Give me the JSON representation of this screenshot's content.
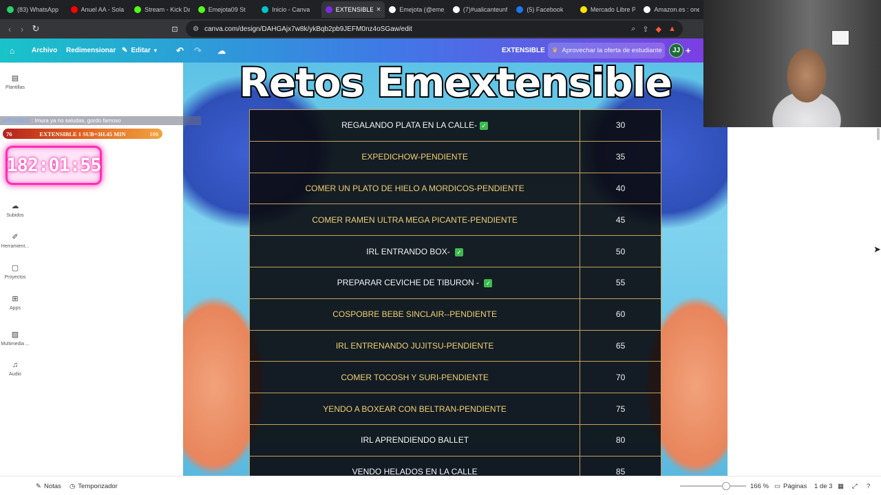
{
  "browser": {
    "tabs": [
      {
        "title": "(83) WhatsApp",
        "favicon_color": "#25d366",
        "icon": "whatsapp-icon"
      },
      {
        "title": "Anuel AA - Sola",
        "favicon_color": "#ff0000",
        "icon": "youtube-icon"
      },
      {
        "title": "Stream - Kick Da",
        "favicon_color": "#53fc18",
        "icon": "kick-icon"
      },
      {
        "title": "Emejota09 St",
        "favicon_color": "#53fc18",
        "icon": "kick-icon"
      },
      {
        "title": "Inicio - Canva",
        "favicon_color": "#00c4cc",
        "icon": "canva-icon"
      },
      {
        "title": "EXTENSIBLE",
        "favicon_color": "#7d2ae8",
        "icon": "canva-icon",
        "active": true
      },
      {
        "title": "Emejota (@emej",
        "favicon_color": "#ffffff",
        "icon": "tiktok-icon"
      },
      {
        "title": "(7)#ualicanteunf",
        "favicon_color": "#ffffff",
        "icon": "tiktok-icon"
      },
      {
        "title": "(5) Facebook",
        "favicon_color": "#1877f2",
        "icon": "facebook-icon"
      },
      {
        "title": "Mercado Libre P",
        "favicon_color": "#ffe600",
        "icon": "mercadolibre-icon"
      },
      {
        "title": "Amazon.es : one",
        "favicon_color": "#ffffff",
        "icon": "amazon-icon"
      }
    ],
    "url": "canva.com/design/DAHGAjx7w8k/ykBqb2pb9JEFM0nz4oSGaw/edit"
  },
  "canva_header": {
    "archivo": "Archivo",
    "redimensionar": "Redimensionar",
    "editar": "Editar",
    "design_name": "EXTENSIBLE",
    "promo": "Aprovechar la oferta de estudiante",
    "avatar": "JJ"
  },
  "sidebar": {
    "items": [
      {
        "label": "Plantillas",
        "icon": "templates-icon"
      },
      {
        "label": "Subidos",
        "icon": "upload-cloud-icon"
      },
      {
        "label": "Herramient...",
        "icon": "tools-icon"
      },
      {
        "label": "Proyectos",
        "icon": "folder-icon"
      },
      {
        "label": "Apps",
        "icon": "apps-icon"
      },
      {
        "label": "Multimedia ...",
        "icon": "multimedia-icon"
      },
      {
        "label": "Audio",
        "icon": "music-icon"
      }
    ]
  },
  "design": {
    "title": "Retos Emextensible",
    "rows": [
      {
        "task": "REGALANDO PLATA EN LA CALLE-",
        "done": true,
        "value": "30"
      },
      {
        "task": "EXPEDICHOW-PENDIENTE",
        "done": false,
        "value": "35"
      },
      {
        "task": "COMER UN PLATO DE HIELO A MORDICOS-PENDIENTE",
        "done": false,
        "value": "40"
      },
      {
        "task": "COMER RAMEN ULTRA MEGA PICANTE-PENDIENTE",
        "done": false,
        "value": "45"
      },
      {
        "task": "IRL ENTRANDO BOX- ",
        "done": true,
        "value": "50"
      },
      {
        "task": "PREPARAR CEVICHE DE TIBURON - ",
        "done": true,
        "value": "55"
      },
      {
        "task": "COSPOBRE BEBE SINCLAIR--PENDIENTE",
        "done": false,
        "value": "60"
      },
      {
        "task": "IRL ENTRENANDO JUJITSU-PENDIENTE",
        "done": false,
        "value": "65"
      },
      {
        "task": "COMER TOCOSH Y SURI-PENDIENTE",
        "done": false,
        "value": "70"
      },
      {
        "task": "YENDO A BOXEAR CON BELTRAN-PENDIENTE",
        "done": false,
        "value": "75"
      },
      {
        "task": "IRL APRENDIENDO BALLET",
        "done": true,
        "value": "80"
      },
      {
        "task": "VENDO HELADOS EN LA CALLE",
        "done": true,
        "value": "85"
      }
    ],
    "check_glyph": "✓"
  },
  "overlays": {
    "chat_user": "jeffrey9811",
    "chat_message": ": Imura ya no saludas, gordo famoso",
    "subbar_left": "76",
    "subbar_text": "EXTENSIBLE 1 SUB=3H.45 MIN",
    "subbar_right": "100",
    "subbar_progress": 0.76,
    "timer": "182:01:55"
  },
  "bottom_bar": {
    "notas": "Notas",
    "temporizador": "Temporizador",
    "zoom": "166 %",
    "paginas": "Páginas",
    "page_indicator": "1 de 3"
  },
  "colors": {
    "header_gradient_start": "#19c3c9",
    "header_gradient_end": "#7b3fe4",
    "pending_text": "#f0cf72",
    "done_text": "#f5f5f5",
    "check_green": "#3fb950",
    "table_border": "#c8a15c",
    "timer_glow": "#ff2fb2"
  }
}
